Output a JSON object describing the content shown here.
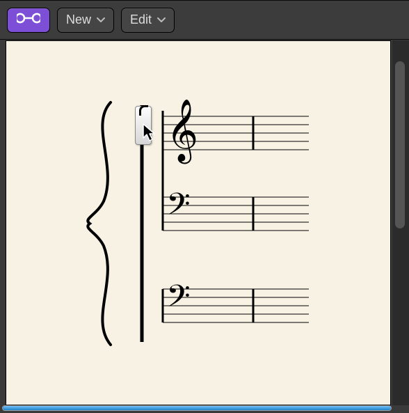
{
  "toolbar": {
    "new_label": "New",
    "edit_label": "Edit"
  },
  "score": {
    "systems": [
      {
        "group": "piano",
        "staves": [
          {
            "clef": "treble",
            "lines": 5
          },
          {
            "clef": "bass",
            "lines": 5
          }
        ],
        "brace": true,
        "barlines": [
          "system-start",
          "mid",
          "end-open"
        ]
      },
      {
        "group": "single",
        "staves": [
          {
            "clef": "bass",
            "lines": 5
          }
        ],
        "barlines": [
          "start",
          "mid",
          "end-open"
        ]
      }
    ],
    "interaction": {
      "cursor_at": "group-bracket-handle",
      "action": "dragging-bracket"
    }
  },
  "colors": {
    "accent": "#7d4fd6",
    "paper": "#f7f2e3",
    "toolbar": "#3c3c3c"
  }
}
